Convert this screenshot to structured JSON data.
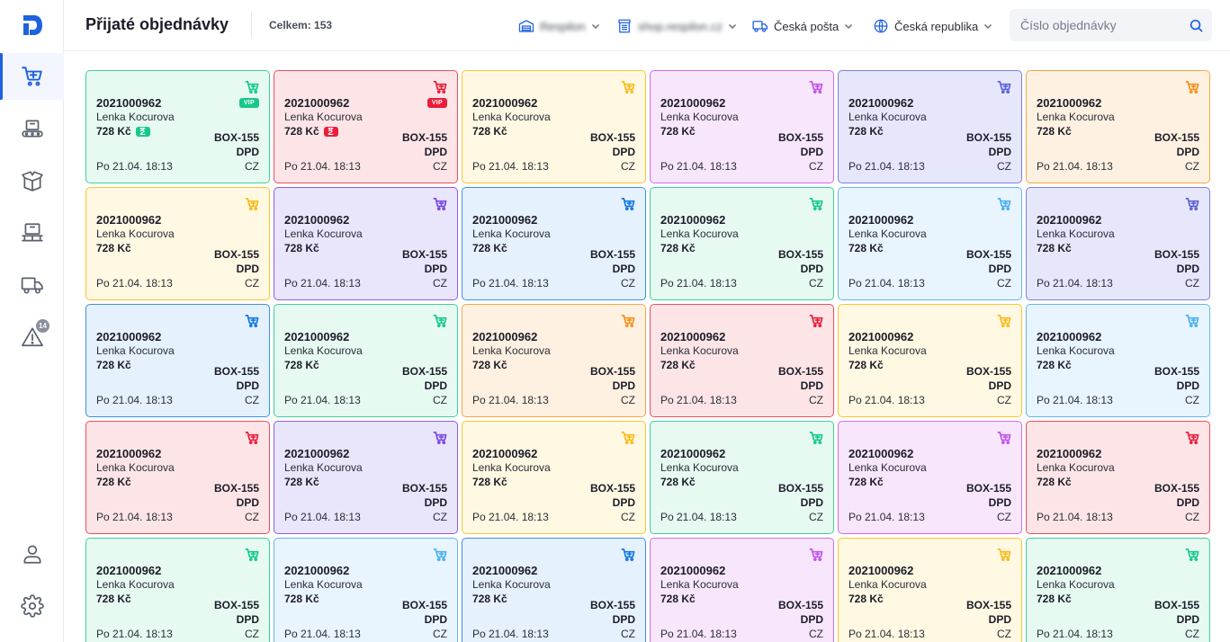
{
  "header": {
    "title": "Přijaté objednávky",
    "total": "Celkem: 153",
    "warehouse": "Respilon",
    "shop": "shop.respilon.cz",
    "carrier": "Česká pošta",
    "country": "Česká republika",
    "search_placeholder": "Číslo objednávky"
  },
  "sidebar": {
    "alerts_badge": "14"
  },
  "colors": {
    "green": "#16c98a",
    "red": "#ec1c3b",
    "yellow": "#f8bc1a",
    "pink": "#c155ea",
    "indigo": "#5d61d8",
    "orange": "#f5921e",
    "blue": "#1477e0",
    "lightblue": "#4bb0ef",
    "purple": "#7a48e4",
    "accent": "#1f62e0"
  },
  "cards": [
    {
      "color": "green",
      "vip": "VIP",
      "hourglass": true,
      "number": "2021000962",
      "name": "Lenka Kocurova",
      "price": "728 Kč",
      "box": "BOX-155",
      "carrier": "DPD",
      "date": "Po 21.04. 18:13",
      "country": "CZ"
    },
    {
      "color": "red",
      "vip": "VIP",
      "hourglass": true,
      "number": "2021000962",
      "name": "Lenka Kocurova",
      "price": "728 Kč",
      "box": "BOX-155",
      "carrier": "DPD",
      "date": "Po 21.04. 18:13",
      "country": "CZ"
    },
    {
      "color": "yellow",
      "number": "2021000962",
      "name": "Lenka Kocurova",
      "price": "728 Kč",
      "box": "BOX-155",
      "carrier": "DPD",
      "date": "Po 21.04. 18:13",
      "country": "CZ"
    },
    {
      "color": "pink",
      "number": "2021000962",
      "name": "Lenka Kocurova",
      "price": "728 Kč",
      "box": "BOX-155",
      "carrier": "DPD",
      "date": "Po 21.04. 18:13",
      "country": "CZ"
    },
    {
      "color": "indigo",
      "number": "2021000962",
      "name": "Lenka Kocurova",
      "price": "728 Kč",
      "box": "BOX-155",
      "carrier": "DPD",
      "date": "Po 21.04. 18:13",
      "country": "CZ"
    },
    {
      "color": "orange",
      "number": "2021000962",
      "name": "Lenka Kocurova",
      "price": "728 Kč",
      "box": "BOX-155",
      "carrier": "DPD",
      "date": "Po 21.04. 18:13",
      "country": "CZ"
    },
    {
      "color": "yellow",
      "number": "2021000962",
      "name": "Lenka Kocurova",
      "price": "728 Kč",
      "box": "BOX-155",
      "carrier": "DPD",
      "date": "Po 21.04. 18:13",
      "country": "CZ"
    },
    {
      "color": "purple",
      "number": "2021000962",
      "name": "Lenka Kocurova",
      "price": "728 Kč",
      "box": "BOX-155",
      "carrier": "DPD",
      "date": "Po 21.04. 18:13",
      "country": "CZ"
    },
    {
      "color": "blue",
      "number": "2021000962",
      "name": "Lenka Kocurova",
      "price": "728 Kč",
      "box": "BOX-155",
      "carrier": "DPD",
      "date": "Po 21.04. 18:13",
      "country": "CZ"
    },
    {
      "color": "green",
      "number": "2021000962",
      "name": "Lenka Kocurova",
      "price": "728 Kč",
      "box": "BOX-155",
      "carrier": "DPD",
      "date": "Po 21.04. 18:13",
      "country": "CZ"
    },
    {
      "color": "lightblue",
      "number": "2021000962",
      "name": "Lenka Kocurova",
      "price": "728 Kč",
      "box": "BOX-155",
      "carrier": "DPD",
      "date": "Po 21.04. 18:13",
      "country": "CZ"
    },
    {
      "color": "indigo",
      "number": "2021000962",
      "name": "Lenka Kocurova",
      "price": "728 Kč",
      "box": "BOX-155",
      "carrier": "DPD",
      "date": "Po 21.04. 18:13",
      "country": "CZ"
    },
    {
      "color": "blue",
      "number": "2021000962",
      "name": "Lenka Kocurova",
      "price": "728 Kč",
      "box": "BOX-155",
      "carrier": "DPD",
      "date": "Po 21.04. 18:13",
      "country": "CZ"
    },
    {
      "color": "green",
      "number": "2021000962",
      "name": "Lenka Kocurova",
      "price": "728 Kč",
      "box": "BOX-155",
      "carrier": "DPD",
      "date": "Po 21.04. 18:13",
      "country": "CZ"
    },
    {
      "color": "orange",
      "number": "2021000962",
      "name": "Lenka Kocurova",
      "price": "728 Kč",
      "box": "BOX-155",
      "carrier": "DPD",
      "date": "Po 21.04. 18:13",
      "country": "CZ"
    },
    {
      "color": "red",
      "number": "2021000962",
      "name": "Lenka Kocurova",
      "price": "728 Kč",
      "box": "BOX-155",
      "carrier": "DPD",
      "date": "Po 21.04. 18:13",
      "country": "CZ"
    },
    {
      "color": "yellow",
      "number": "2021000962",
      "name": "Lenka Kocurova",
      "price": "728 Kč",
      "box": "BOX-155",
      "carrier": "DPD",
      "date": "Po 21.04. 18:13",
      "country": "CZ"
    },
    {
      "color": "lightblue",
      "number": "2021000962",
      "name": "Lenka Kocurova",
      "price": "728 Kč",
      "box": "BOX-155",
      "carrier": "DPD",
      "date": "Po 21.04. 18:13",
      "country": "CZ"
    },
    {
      "color": "red",
      "number": "2021000962",
      "name": "Lenka Kocurova",
      "price": "728 Kč",
      "box": "BOX-155",
      "carrier": "DPD",
      "date": "Po 21.04. 18:13",
      "country": "CZ"
    },
    {
      "color": "purple",
      "number": "2021000962",
      "name": "Lenka Kocurova",
      "price": "728 Kč",
      "box": "BOX-155",
      "carrier": "DPD",
      "date": "Po 21.04. 18:13",
      "country": "CZ"
    },
    {
      "color": "yellow",
      "number": "2021000962",
      "name": "Lenka Kocurova",
      "price": "728 Kč",
      "box": "BOX-155",
      "carrier": "DPD",
      "date": "Po 21.04. 18:13",
      "country": "CZ"
    },
    {
      "color": "green",
      "number": "2021000962",
      "name": "Lenka Kocurova",
      "price": "728 Kč",
      "box": "BOX-155",
      "carrier": "DPD",
      "date": "Po 21.04. 18:13",
      "country": "CZ"
    },
    {
      "color": "pink",
      "number": "2021000962",
      "name": "Lenka Kocurova",
      "price": "728 Kč",
      "box": "BOX-155",
      "carrier": "DPD",
      "date": "Po 21.04. 18:13",
      "country": "CZ"
    },
    {
      "color": "red",
      "number": "2021000962",
      "name": "Lenka Kocurova",
      "price": "728 Kč",
      "box": "BOX-155",
      "carrier": "DPD",
      "date": "Po 21.04. 18:13",
      "country": "CZ"
    },
    {
      "color": "green",
      "number": "2021000962",
      "name": "Lenka Kocurova",
      "price": "728 Kč",
      "box": "BOX-155",
      "carrier": "DPD",
      "date": "Po 21.04. 18:13",
      "country": "CZ"
    },
    {
      "color": "lightblue",
      "number": "2021000962",
      "name": "Lenka Kocurova",
      "price": "728 Kč",
      "box": "BOX-155",
      "carrier": "DPD",
      "date": "Po 21.04. 18:13",
      "country": "CZ"
    },
    {
      "color": "blue",
      "number": "2021000962",
      "name": "Lenka Kocurova",
      "price": "728 Kč",
      "box": "BOX-155",
      "carrier": "DPD",
      "date": "Po 21.04. 18:13",
      "country": "CZ"
    },
    {
      "color": "pink",
      "number": "2021000962",
      "name": "Lenka Kocurova",
      "price": "728 Kč",
      "box": "BOX-155",
      "carrier": "DPD",
      "date": "Po 21.04. 18:13",
      "country": "CZ"
    },
    {
      "color": "yellow",
      "number": "2021000962",
      "name": "Lenka Kocurova",
      "price": "728 Kč",
      "box": "BOX-155",
      "carrier": "DPD",
      "date": "Po 21.04. 18:13",
      "country": "CZ"
    },
    {
      "color": "green",
      "number": "2021000962",
      "name": "Lenka Kocurova",
      "price": "728 Kč",
      "box": "BOX-155",
      "carrier": "DPD",
      "date": "Po 21.04. 18:13",
      "country": "CZ"
    }
  ]
}
